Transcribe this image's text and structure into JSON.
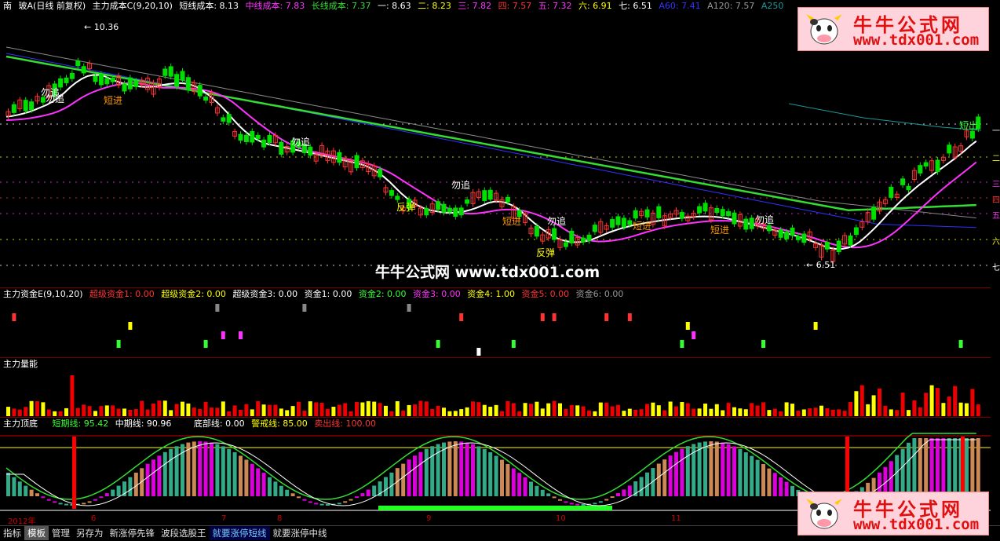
{
  "main_header": {
    "market": "南",
    "stock": "玻A(日线 前复权)",
    "indicator": "主力成本C(9,20,10)",
    "short_cost": "短线成本: 8.13",
    "mid_cost": "中线成本: 7.83",
    "long_cost": "长线成本: 7.37",
    "l1": "一: 8.63",
    "l2": "二: 8.23",
    "l3": "三: 7.82",
    "l4": "四: 7.57",
    "l5": "五: 7.32",
    "l6": "六: 6.91",
    "l7": "七: 6.51",
    "a60": "A60: 7.41",
    "a120": "A120: 7.57",
    "a250": "A250"
  },
  "price_marks": {
    "high": "10.36",
    "low": "6.51"
  },
  "signal_labels": [
    "勿追",
    "短进",
    "勿追",
    "勿追",
    "反弹",
    "短进",
    "勿追",
    "短进",
    "短进",
    "勿追",
    "反弹",
    "勿追",
    "短出"
  ],
  "right_labels": [
    "一",
    "二",
    "三",
    "四",
    "五",
    "六",
    "七"
  ],
  "watermark": "牛牛公式网 www.tdx001.com",
  "fund_header": {
    "name": "主力资金E(9,10,20)",
    "f1": "超级资金1: 0.00",
    "f2": "超级资金2: 0.00",
    "f3": "超级资金3: 0.00",
    "f4": "资金1: 0.00",
    "f5": "资金2: 0.00",
    "f6": "资金3: 0.00",
    "f7": "资金4: 1.00",
    "f8": "资金5: 0.00",
    "f9": "资金6: 0.00"
  },
  "volume_header": {
    "name": "主力量能"
  },
  "top_header": {
    "name": "主力顶底",
    "short_line": "短期线: 95.42",
    "mid_line": "中期线: 90.96",
    "bottom_line": "底部线: 0.00",
    "warn_line": "警戒线: 85.00",
    "sell_line": "卖出线: 100.00"
  },
  "date_axis": [
    "2012年",
    "6",
    "7",
    "8",
    "9",
    "10",
    "11"
  ],
  "tabs": [
    "指标",
    "模板",
    "管理",
    "另存为",
    "新涨停先锋",
    "波段选股王",
    "就要涨停短线",
    "就要涨停中线"
  ],
  "logo": {
    "title": "牛牛公式网",
    "url": "www.tdx001.com"
  },
  "colors": {
    "up": "#ff3232",
    "down": "#00e000",
    "white": "#ffffff",
    "magenta": "#ff33ff",
    "green_line": "#33dd33",
    "blue_line": "#3030ff",
    "gray_line": "#888888",
    "teal_line": "#1a9a9a"
  }
}
